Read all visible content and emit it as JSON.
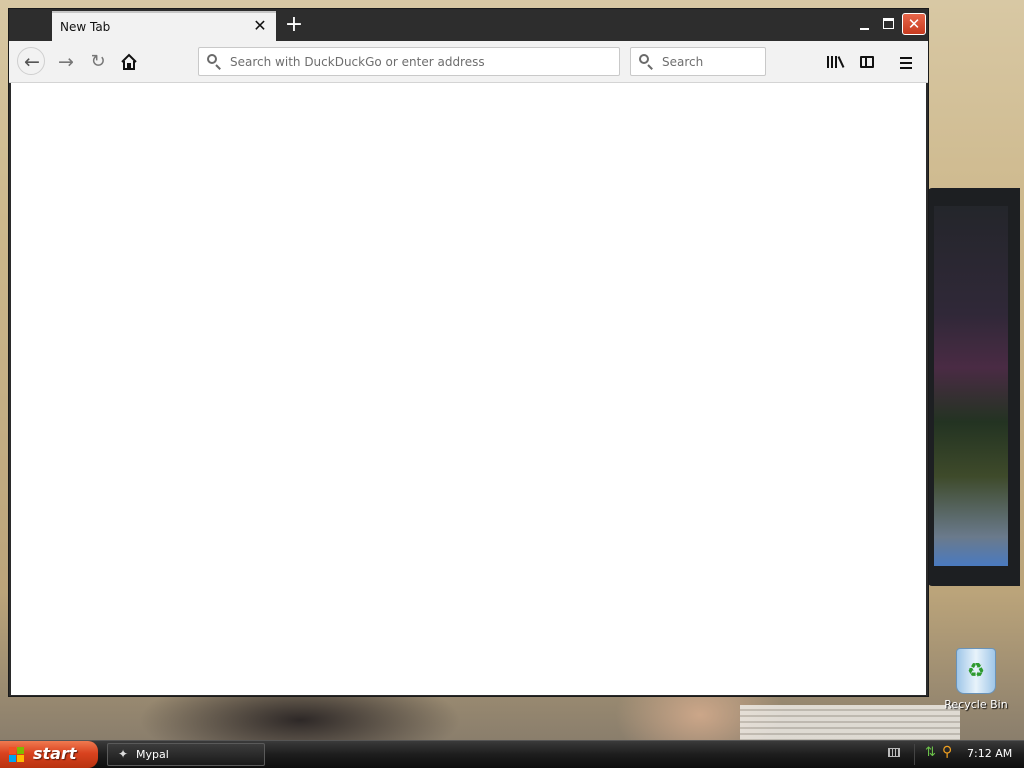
{
  "browser": {
    "tab": {
      "title": "New Tab"
    },
    "urlbar": {
      "placeholder": "Search with DuckDuckGo or enter address",
      "value": ""
    },
    "searchbar": {
      "placeholder": "Search",
      "value": ""
    },
    "icons": {
      "back": "arrow-left-icon",
      "forward": "arrow-right-icon",
      "reload": "reload-icon",
      "home": "home-icon",
      "library": "library-icon",
      "sidebar": "sidebar-icon",
      "menu": "hamburger-menu-icon"
    }
  },
  "desktop": {
    "recycle_bin_label": "Recycle Bin"
  },
  "taskbar": {
    "start_label": "start",
    "items": [
      {
        "label": "Mypal"
      }
    ],
    "clock": "7:12 AM"
  },
  "colors": {
    "titlebar": "#2d2d2d",
    "toolbar": "#f2f2f2",
    "close_button": "#d9482a",
    "start_button": "#d9431f"
  }
}
